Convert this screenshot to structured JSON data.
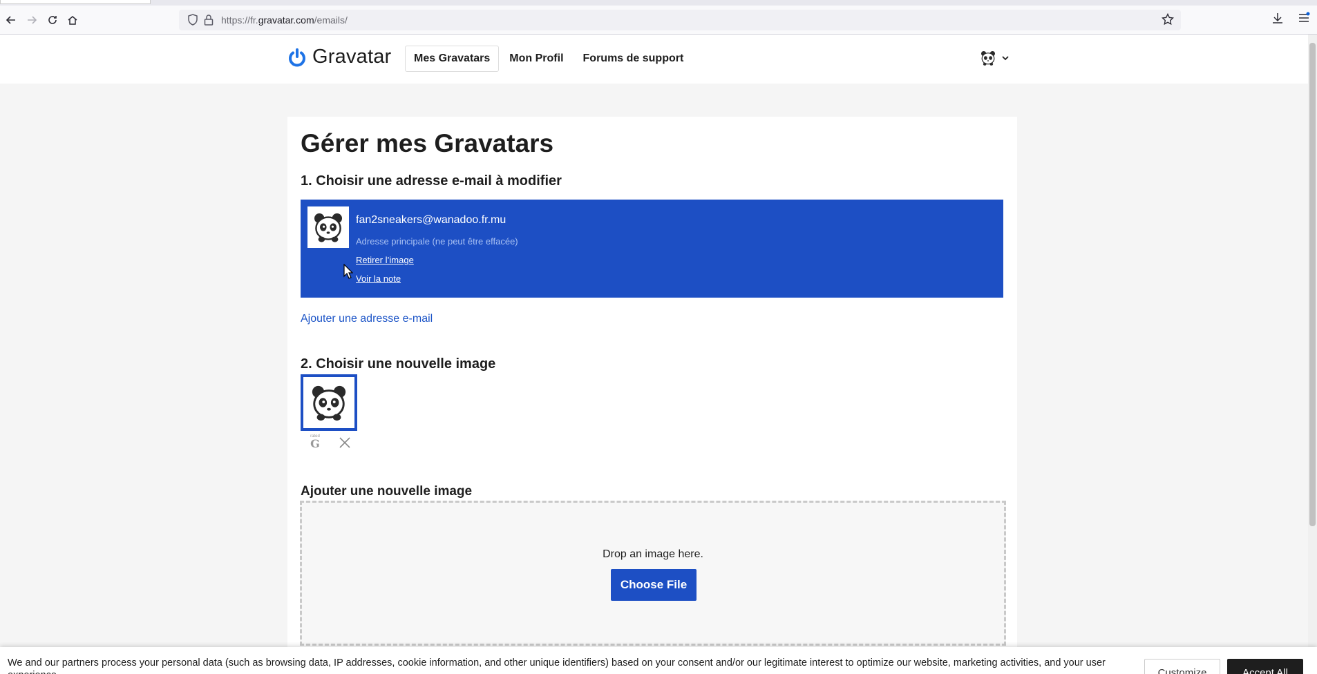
{
  "browser": {
    "url_prefix": "https://fr.",
    "url_domain": "gravatar.com",
    "url_path": "/emails/"
  },
  "header": {
    "logo_text": "Gravatar",
    "nav": [
      {
        "label": "Mes Gravatars",
        "active": true
      },
      {
        "label": "Mon Profil",
        "active": false
      },
      {
        "label": "Forums de support",
        "active": false
      }
    ]
  },
  "main": {
    "title": "Gérer mes Gravatars",
    "step1_title": "1. Choisir une adresse e-mail à modifier",
    "email": {
      "address": "fan2sneakers@wanadoo.fr.mu",
      "note": "Adresse principale (ne peut être effacée)",
      "remove_image": "Retirer l’image",
      "view_rating": "Voir la note"
    },
    "add_email": "Ajouter une adresse e-mail",
    "step2_title": "2. Choisir une nouvelle image",
    "rating_small": "rated",
    "rating_letter": "G",
    "add_image_title": "Ajouter une nouvelle image",
    "drop_text": "Drop an image here.",
    "choose_file": "Choose File"
  },
  "cookie": {
    "text": "We and our partners process your personal data (such as browsing data, IP addresses, cookie information, and other unique identifiers) based on your consent and/or our legitimate interest to optimize our website, marketing activities, and your user experience.",
    "customize": "Customize",
    "accept": "Accept All"
  },
  "colors": {
    "accent": "#1d4fc4",
    "link": "#1d55c7",
    "logo": "#1e73e6"
  }
}
